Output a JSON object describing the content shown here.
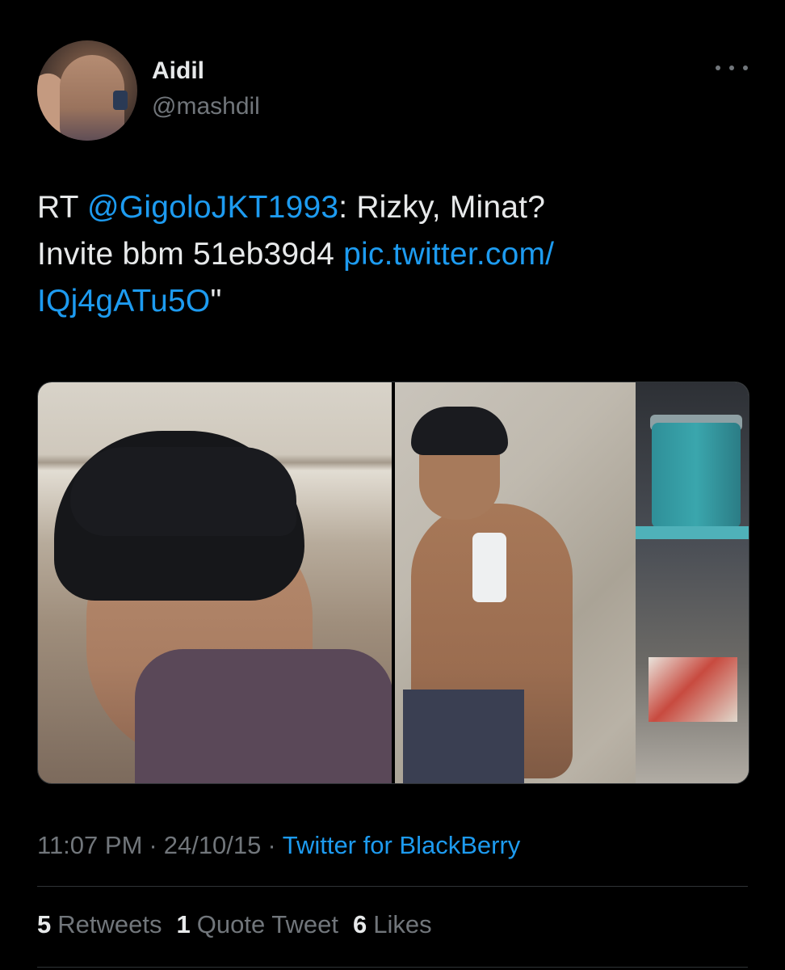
{
  "tweet": {
    "author": {
      "display_name": "Aidil",
      "handle": "@mashdil"
    },
    "text": {
      "prefix": "RT ",
      "mention": "@GigoloJKT1993",
      "line1_rest": ": Rizky, Minat?",
      "line2_text": "Invite bbm 51eb39d4 ",
      "link_part1": "pic.twitter.com/",
      "link_part2": "IQj4gATu5O",
      "suffix": "\""
    },
    "media": [
      {
        "kind": "photo",
        "icon": "selfie-portrait"
      },
      {
        "kind": "photo",
        "icon": "mirror-selfie"
      }
    ],
    "meta": {
      "time": "11:07 PM",
      "separator": "·",
      "date": "24/10/15",
      "source": "Twitter for BlackBerry"
    },
    "stats": {
      "retweets_count": "5",
      "retweets_label": "Retweets",
      "quotes_count": "1",
      "quotes_label": "Quote Tweet",
      "likes_count": "6",
      "likes_label": "Likes"
    }
  },
  "colors": {
    "background": "#000000",
    "text": "#e7e9ea",
    "muted": "#71767b",
    "link": "#1d9bf0",
    "border": "#2f3336"
  }
}
